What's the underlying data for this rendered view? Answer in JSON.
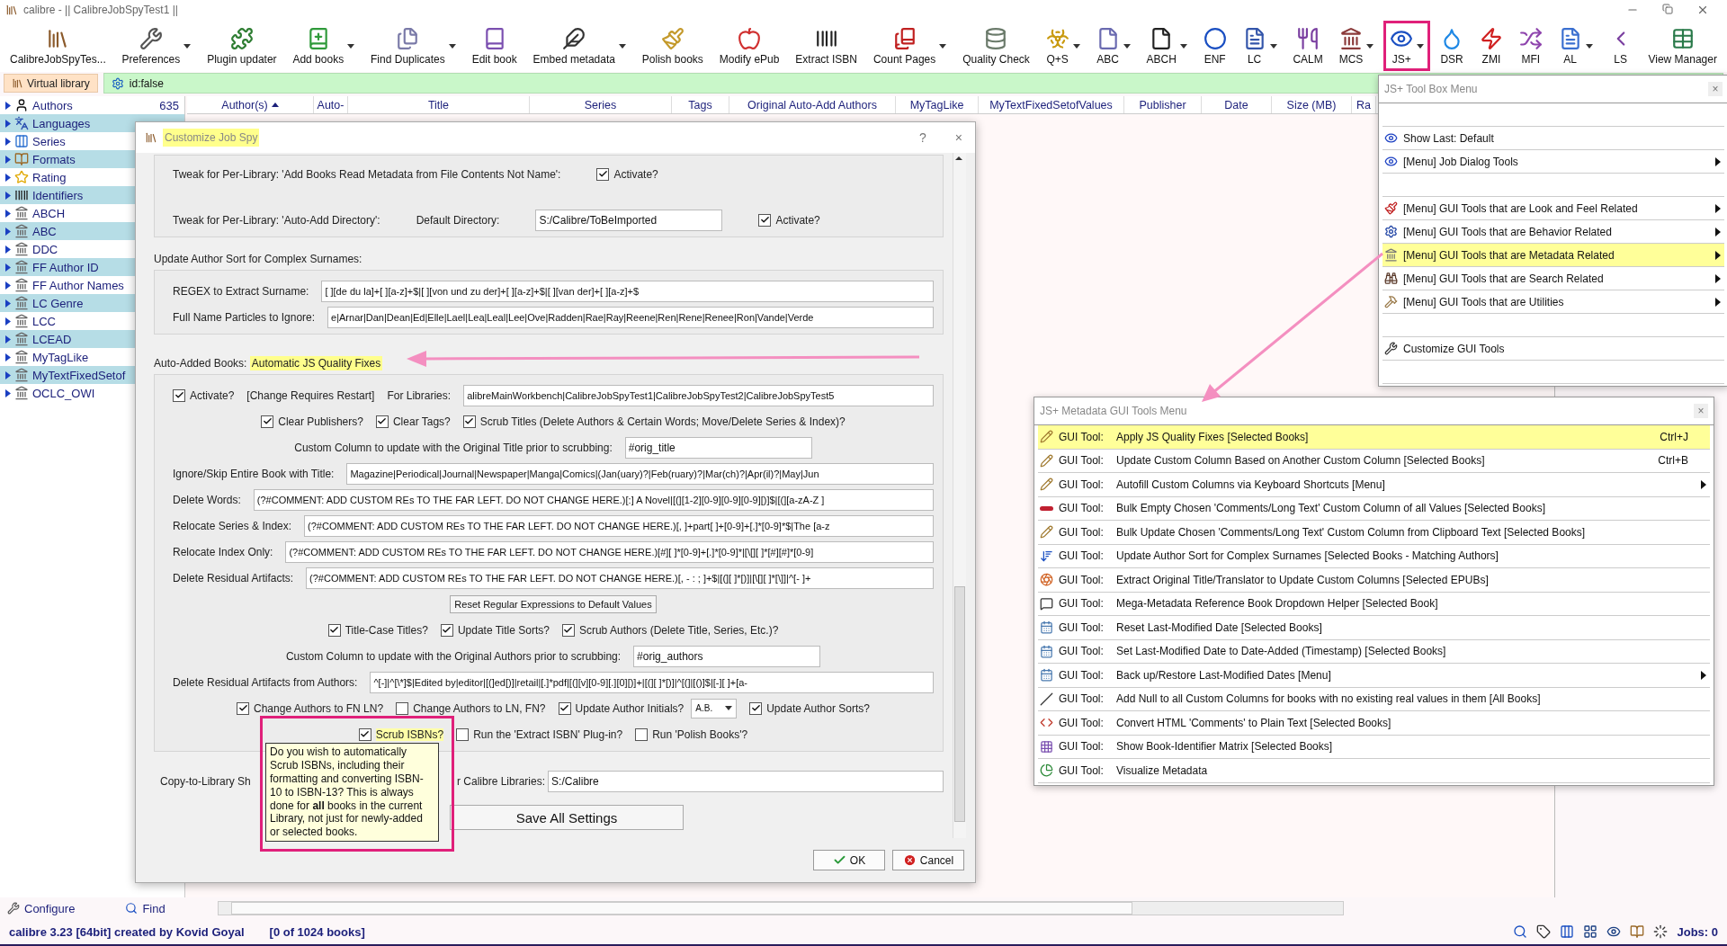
{
  "window": {
    "title": "calibre - || CalibreJobSpyTest1 ||"
  },
  "toolbar": [
    {
      "label": "CalibreJobSpyTes...",
      "dropdown": false,
      "highlighted": false
    },
    {
      "label": "Preferences",
      "dropdown": true,
      "highlighted": false
    },
    {
      "label": "Plugin updater",
      "dropdown": false,
      "highlighted": false
    },
    {
      "label": "Add books",
      "dropdown": true,
      "highlighted": false
    },
    {
      "label": "Find Duplicates",
      "dropdown": true,
      "highlighted": false
    },
    {
      "label": "Edit book",
      "dropdown": false,
      "highlighted": false
    },
    {
      "label": "Embed metadata",
      "dropdown": true,
      "highlighted": false
    },
    {
      "label": "Polish books",
      "dropdown": false,
      "highlighted": false
    },
    {
      "label": "Modify ePub",
      "dropdown": false,
      "highlighted": false
    },
    {
      "label": "Extract ISBN",
      "dropdown": false,
      "highlighted": false
    },
    {
      "label": "Count Pages",
      "dropdown": true,
      "highlighted": false
    },
    {
      "label": "Quality Check",
      "dropdown": false,
      "highlighted": false
    },
    {
      "label": "Q+S",
      "dropdown": true,
      "highlighted": false
    },
    {
      "label": "ABC",
      "dropdown": true,
      "highlighted": false
    },
    {
      "label": "ABCH",
      "dropdown": true,
      "highlighted": false
    },
    {
      "label": "ENF",
      "dropdown": false,
      "highlighted": false
    },
    {
      "label": "LC",
      "dropdown": true,
      "highlighted": false
    },
    {
      "label": "CALM",
      "dropdown": false,
      "highlighted": false
    },
    {
      "label": "MCS",
      "dropdown": true,
      "highlighted": false
    },
    {
      "label": "JS+",
      "dropdown": true,
      "highlighted": true
    },
    {
      "label": "DSR",
      "dropdown": false,
      "highlighted": false
    },
    {
      "label": "ZMI",
      "dropdown": false,
      "highlighted": false
    },
    {
      "label": "MFI",
      "dropdown": false,
      "highlighted": false
    },
    {
      "label": "AL",
      "dropdown": true,
      "highlighted": false
    },
    {
      "label": "LS",
      "dropdown": false,
      "highlighted": false
    },
    {
      "label": "View Manager",
      "dropdown": false,
      "highlighted": false
    }
  ],
  "search_bar": {
    "virtual_library": "Virtual library",
    "query": "id:false"
  },
  "tag_browser": [
    {
      "label": "Authors",
      "count": "635"
    },
    {
      "label": "Languages"
    },
    {
      "label": "Series"
    },
    {
      "label": "Formats"
    },
    {
      "label": "Rating"
    },
    {
      "label": "Identifiers"
    },
    {
      "label": "ABCH"
    },
    {
      "label": "ABC"
    },
    {
      "label": "DDC"
    },
    {
      "label": "FF Author ID"
    },
    {
      "label": "FF Author Names"
    },
    {
      "label": "LC Genre"
    },
    {
      "label": "LCC"
    },
    {
      "label": "LCEAD"
    },
    {
      "label": "MyTagLike"
    },
    {
      "label": "MyTextFixedSetof"
    },
    {
      "label": "OCLC_OWI"
    }
  ],
  "book_list": {
    "columns": [
      {
        "label": "Author(s)",
        "sorted": true
      },
      {
        "label": "Auto-"
      },
      {
        "label": "Title"
      },
      {
        "label": "Series"
      },
      {
        "label": "Tags"
      },
      {
        "label": "Original Auto-Add Authors"
      },
      {
        "label": "MyTagLike"
      },
      {
        "label": "MyTextFixedSetofValues"
      },
      {
        "label": "Publisher"
      },
      {
        "label": "Date"
      },
      {
        "label": "Size (MB)"
      },
      {
        "label": "Ra"
      }
    ]
  },
  "bottom_buttons": {
    "configure": "Configure",
    "find": "Find"
  },
  "status_bar": {
    "version": "calibre 3.23 [64bit] created by Kovid Goyal",
    "count": "[0 of 1024 books]",
    "jobs": "Jobs: 0"
  },
  "dialog": {
    "title": "Customize Job Spy",
    "title_highlighted": true,
    "help": "?",
    "close": "×",
    "groups": [
      {
        "rows": [
          {
            "items": [
              {
                "kind": "label",
                "text": "Tweak for Per-Library: 'Add Books Read Metadata from File Contents Not Name':"
              },
              {
                "kind": "checkbox",
                "label": "Activate?",
                "checked": true,
                "highlighted": false
              }
            ]
          },
          {
            "items": [
              {
                "kind": "label",
                "text": "Tweak for Per-Library: 'Auto-Add Directory':"
              },
              {
                "kind": "label",
                "text": "Default Directory:"
              },
              {
                "kind": "short_field",
                "value": "S:/Calibre/ToBeImported"
              },
              {
                "kind": "checkbox",
                "label": "Activate?",
                "checked": true,
                "highlighted": false
              }
            ]
          }
        ]
      },
      {
        "heading": "Update Author Sort for Complex Surnames:",
        "rows": [
          {
            "items": [
              {
                "kind": "label",
                "text": "REGEX to Extract Surname:"
              },
              {
                "kind": "field",
                "value": "[ ][de du la]+[ ][a-z]+$|[ ][von und zu der]+[ ][a-z]+$|[ ][van der]+[ ][a-z]+$"
              }
            ]
          },
          {
            "items": [
              {
                "kind": "label",
                "text": "Full Name Particles to Ignore:"
              },
              {
                "kind": "field",
                "value": "e|Arnar|Dan|Dean|Ed|Elle|Lael|Lea|Leal|Lee|Ove|Radden|Rae|Ray|Reene|Ren|Rene|Renee|Ron|Vande|Verde"
              }
            ]
          }
        ]
      },
      {
        "heading": "Auto-Added Books:",
        "heading_mark": "Automatic JS Quality Fixes",
        "heading_mark_highlighted": true,
        "rows": [
          {
            "items": [
              {
                "kind": "checkbox",
                "label": "Activate?",
                "checked": true,
                "highlighted": false
              },
              {
                "kind": "label",
                "text": "[Change Requires Restart]"
              },
              {
                "kind": "label",
                "text": "For Libraries:"
              },
              {
                "kind": "field",
                "value": "alibreMainWorkbench|CalibreJobSpyTest1|CalibreJobSpyTest2|CalibreJobSpyTest5"
              }
            ]
          },
          {
            "items": [
              {
                "kind": "checkbox",
                "label": "Clear Publishers?",
                "checked": true,
                "highlighted": false
              },
              {
                "kind": "checkbox",
                "label": "Clear Tags?",
                "checked": true,
                "highlighted": false
              },
              {
                "kind": "checkbox",
                "label": "Scrub Titles (Delete Authors & Certain Words; Move/Delete Series & Index)?",
                "checked": true,
                "highlighted": false
              }
            ]
          },
          {
            "items": [
              {
                "kind": "label",
                "text": "Custom Column to update with the Original Title prior to scrubbing:"
              },
              {
                "kind": "short_field",
                "value": "#orig_title"
              }
            ]
          },
          {
            "items": [
              {
                "kind": "label",
                "text": "Ignore/Skip Entire Book with Title:"
              },
              {
                "kind": "field",
                "value": "Magazine|Periodical|Journal|Newspaper|Manga|Comics|(Jan(uary)?|Feb(ruary)?|Mar(ch)?|Apr(il)?|May|Jun"
              }
            ]
          },
          {
            "items": [
              {
                "kind": "label",
                "text": "Delete Words:"
              },
              {
                "kind": "field",
                "value": "(?#COMMENT: ADD CUSTOM REs TO THE FAR LEFT. DO NOT CHANGE HERE.)[:] A Novel|[(][1-2][0-9][0-9][0-9][)]$|[(][a-zA-Z ]"
              }
            ]
          },
          {
            "items": [
              {
                "kind": "label",
                "text": "Relocate Series & Index:"
              },
              {
                "kind": "field",
                "value": "(?#COMMENT: ADD CUSTOM REs TO THE FAR LEFT. DO NOT CHANGE HERE.)[, ]+part[ ]+[0-9]+[.]*[0-9]*$|The [a-z"
              }
            ]
          },
          {
            "items": [
              {
                "kind": "label",
                "text": "Relocate Index Only:"
              },
              {
                "kind": "field",
                "value": "(?#COMMENT: ADD CUSTOM REs TO THE FAR LEFT. DO NOT CHANGE HERE.)[#][ ]*[0-9]+[.]*[0-9]*|[\\[][ ]*[#][#]*[0-9]"
              }
            ]
          },
          {
            "items": [
              {
                "kind": "label",
                "text": "Delete Residual Artifacts:"
              },
              {
                "kind": "field",
                "value": "(?#COMMENT: ADD CUSTOM REs TO THE FAR LEFT. DO NOT CHANGE HERE.)[, - : ; ]+$|[(][ ]*[)]|[\\[][ ]*[\\]]|^[- ]+"
              }
            ]
          },
          {
            "items": [
              {
                "kind": "button",
                "label": "Reset Regular Expressions to Default Values"
              }
            ]
          },
          {
            "items": [
              {
                "kind": "checkbox",
                "label": "Title-Case Titles?",
                "checked": true,
                "highlighted": false
              },
              {
                "kind": "checkbox",
                "label": "Update Title Sorts?",
                "checked": true,
                "highlighted": false
              },
              {
                "kind": "checkbox",
                "label": "Scrub Authors (Delete Title, Series, Etc.)?",
                "checked": true,
                "highlighted": false
              }
            ]
          },
          {
            "items": [
              {
                "kind": "label",
                "text": "Custom Column to update with the Original Authors prior to scrubbing:"
              },
              {
                "kind": "short_field",
                "value": "#orig_authors"
              }
            ]
          },
          {
            "items": [
              {
                "kind": "label",
                "text": "Delete Residual Artifacts from Authors:"
              },
              {
                "kind": "field",
                "value": "^[-]|^[\\*]$|Edited by|editor|[(]ed[)]|retail|[.]*pdf|[(][v][0-9][.][0][)]+|[(][ ]*[)]|^[(]|[()]$|[-][ ]+[a-"
              }
            ]
          },
          {
            "items": [
              {
                "kind": "checkbox",
                "label": "Change Authors to FN LN?",
                "checked": true,
                "highlighted": false
              },
              {
                "kind": "checkbox",
                "label": "Change Authors to LN, FN?",
                "checked": false,
                "highlighted": false
              },
              {
                "kind": "checkbox",
                "label": "Update Author Initials?",
                "checked": true,
                "highlighted": false
              },
              {
                "kind": "combo",
                "value": "A.B."
              },
              {
                "kind": "checkbox",
                "label": "Update Author Sorts?",
                "checked": true,
                "highlighted": false
              }
            ]
          },
          {
            "items": [
              {
                "kind": "checkbox",
                "label": "Scrub ISBNs?",
                "checked": true,
                "highlighted": true
              },
              {
                "kind": "checkbox",
                "label": "Run the 'Extract ISBN' Plug-in?",
                "checked": false,
                "highlighted": false
              },
              {
                "kind": "checkbox",
                "label": "Run 'Polish Books'?",
                "checked": false,
                "highlighted": false
              }
            ]
          }
        ]
      }
    ],
    "copy_row": {
      "label_start": "Copy-to-Library Sh",
      "label_end": "r Calibre Libraries:",
      "value": "S:/Calibre"
    },
    "save_button": "Save All Settings",
    "ok": "OK",
    "cancel": "Cancel"
  },
  "tooltip": {
    "text": "Do you wish to automatically Scrub ISBNs, including their formatting and converting ISBN-10 to ISBN-13? This is always done for **all** books in the current Library, not just for newly-added or selected books."
  },
  "toolbox_menu": {
    "title": "JS+ Tool Box Menu",
    "close": "×",
    "items": [
      {
        "kind": "spacer"
      },
      {
        "kind": "item",
        "label": "Show Last: Default",
        "submenu": false,
        "highlighted": false
      },
      {
        "kind": "item",
        "label": "[Menu] Job Dialog Tools",
        "submenu": true,
        "highlighted": false
      },
      {
        "kind": "spacer"
      },
      {
        "kind": "item",
        "label": "[Menu] GUI Tools that are Look and Feel Related",
        "submenu": true,
        "highlighted": false
      },
      {
        "kind": "item",
        "label": "[Menu] GUI Tools that are Behavior Related",
        "submenu": true,
        "highlighted": false
      },
      {
        "kind": "item",
        "label": "[Menu] GUI Tools that are Metadata Related",
        "submenu": true,
        "highlighted": true
      },
      {
        "kind": "item",
        "label": "[Menu] GUI Tools that are Search Related",
        "submenu": true,
        "highlighted": false
      },
      {
        "kind": "item",
        "label": "[Menu] GUI Tools that are Utilities",
        "submenu": true,
        "highlighted": false
      },
      {
        "kind": "spacer"
      },
      {
        "kind": "item",
        "label": "Customize GUI Tools",
        "submenu": false,
        "highlighted": false
      },
      {
        "kind": "spacer"
      }
    ]
  },
  "metadata_menu": {
    "title": "JS+ Metadata GUI Tools Menu",
    "close": "×",
    "items": [
      {
        "prefix": "GUI Tool:",
        "label": "Apply JS Quality Fixes [Selected Books]",
        "shortcut": "Ctrl+J",
        "submenu": false,
        "highlighted": true
      },
      {
        "prefix": "GUI Tool:",
        "label": "Update Custom Column Based on Another Custom Column [Selected Books]",
        "shortcut": "Ctrl+B",
        "submenu": false,
        "highlighted": false
      },
      {
        "prefix": "GUI Tool:",
        "label": "Autofill Custom Columns via Keyboard Shortcuts [Menu]",
        "submenu": true,
        "highlighted": false
      },
      {
        "prefix": "GUI Tool:",
        "label": "Bulk Empty Chosen 'Comments/Long Text' Custom Column of all Values [Selected Books]",
        "submenu": false,
        "highlighted": false
      },
      {
        "prefix": "GUI Tool:",
        "label": "Bulk Update Chosen 'Comments/Long Text' Custom Column from Clipboard Text [Selected Books]",
        "submenu": false,
        "highlighted": false
      },
      {
        "prefix": "GUI Tool:",
        "label": "Update Author Sort for Complex Surnames [Selected Books - Matching Authors]",
        "submenu": false,
        "highlighted": false
      },
      {
        "prefix": "GUI Tool:",
        "label": "Extract Original Title/Translator to Update Custom Columns [Selected EPUBs]",
        "submenu": false,
        "highlighted": false
      },
      {
        "prefix": "GUI Tool:",
        "label": "Mega-Metadata Reference Book Dropdown Helper [Selected Book]",
        "submenu": false,
        "highlighted": false
      },
      {
        "prefix": "GUI Tool:",
        "label": "Reset Last-Modified Date [Selected Books]",
        "submenu": false,
        "highlighted": false
      },
      {
        "prefix": "GUI Tool:",
        "label": "Set Last-Modified Date to Date-Added (Timestamp) [Selected Books]",
        "submenu": false,
        "highlighted": false
      },
      {
        "prefix": "GUI Tool:",
        "label": "Back up/Restore Last-Modified Dates [Menu]",
        "submenu": true,
        "highlighted": false
      },
      {
        "prefix": "GUI Tool:",
        "label": "Add Null to all Custom Columns for books with no existing real values in them [All Books]",
        "submenu": false,
        "highlighted": false
      },
      {
        "prefix": "GUI Tool:",
        "label": "Convert HTML 'Comments' to Plain Text [Selected Books]",
        "submenu": false,
        "highlighted": false
      },
      {
        "prefix": "GUI Tool:",
        "label": "Show Book-Identifier Matrix [Selected Books]",
        "submenu": false,
        "highlighted": false
      },
      {
        "prefix": "GUI Tool:",
        "label": "Visualize Metadata",
        "submenu": false,
        "highlighted": false
      }
    ]
  }
}
